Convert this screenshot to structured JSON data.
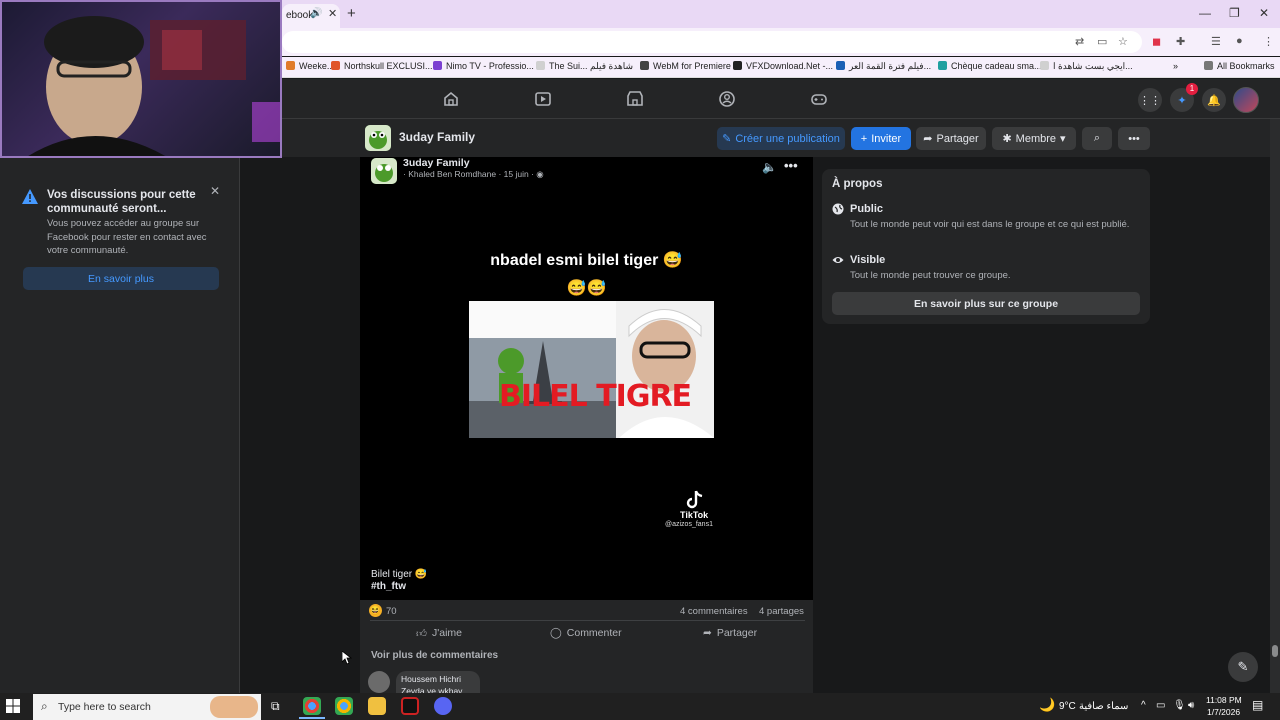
{
  "browser": {
    "active_tab_title": "ebook",
    "bookmarks": [
      {
        "label": "Weeke...",
        "color": "#e07b2a"
      },
      {
        "label": "Northskull EXCLUSI...",
        "color": "#e0542a"
      },
      {
        "label": "Nimo TV - Professio...",
        "color": "#7b3fd1"
      },
      {
        "label": "The Sui... شاهدة فيلم",
        "color": "#d0d0d0"
      },
      {
        "label": "WebM for Premiere",
        "color": "#444444"
      },
      {
        "label": "VFXDownload.Net -...",
        "color": "#222222"
      },
      {
        "label": "فيلم فترة القمة العر...",
        "color": "#1a5fb4"
      },
      {
        "label": "Chèque cadeau sma...",
        "color": "#20a0a0"
      },
      {
        "label": "ايجي بست شاهدة ا...",
        "color": "#d0d0d0"
      }
    ],
    "all_bookmarks_label": "All Bookmarks"
  },
  "facebook": {
    "notification_count": "1",
    "group": {
      "name": "3uday Family",
      "create_post_label": "Créer une publication",
      "invite_label": "Inviter",
      "share_label": "Partager",
      "member_label": "Membre"
    },
    "notice": {
      "title": "Vos discussions pour cette communauté seront...",
      "body": "Vous pouvez accéder au groupe sur Facebook pour rester en contact avec votre communauté.",
      "button": "En savoir plus"
    },
    "post": {
      "group_name": "3uday Family",
      "author": "Khaled Ben Romdhane",
      "date": "15 juin",
      "video_caption_line1": "nbadel esmi bilel tiger 😅",
      "video_caption_line2": "😅😅",
      "thumb_overlay_text": "BILEL TIGRE",
      "tiktok_name": "TikTok",
      "tiktok_handle": "@azizos_fans1",
      "caption": "Bilel tiger 😅",
      "hashtag": "#th_ftw",
      "reaction_count": "70",
      "comments_count": "4 commentaires",
      "shares_count": "4 partages",
      "like_label": "J'aime",
      "comment_label": "Commenter",
      "share_label": "Partager",
      "more_comments": "Voir plus de commentaires",
      "first_comment": {
        "author": "Houssem Hichri",
        "text": "Zeyda ye wkhay"
      }
    },
    "about": {
      "title": "À propos",
      "public_title": "Public",
      "public_desc": "Tout le monde peut voir qui est dans le groupe et ce qui est publié.",
      "visible_title": "Visible",
      "visible_desc": "Tout le monde peut trouver ce groupe.",
      "button": "En savoir plus sur ce groupe"
    }
  },
  "taskbar": {
    "search_placeholder": "Type here to search",
    "temperature": "9°C",
    "weather": "سماء صافية",
    "time": "11:08 PM",
    "date": "1/7/2026"
  }
}
